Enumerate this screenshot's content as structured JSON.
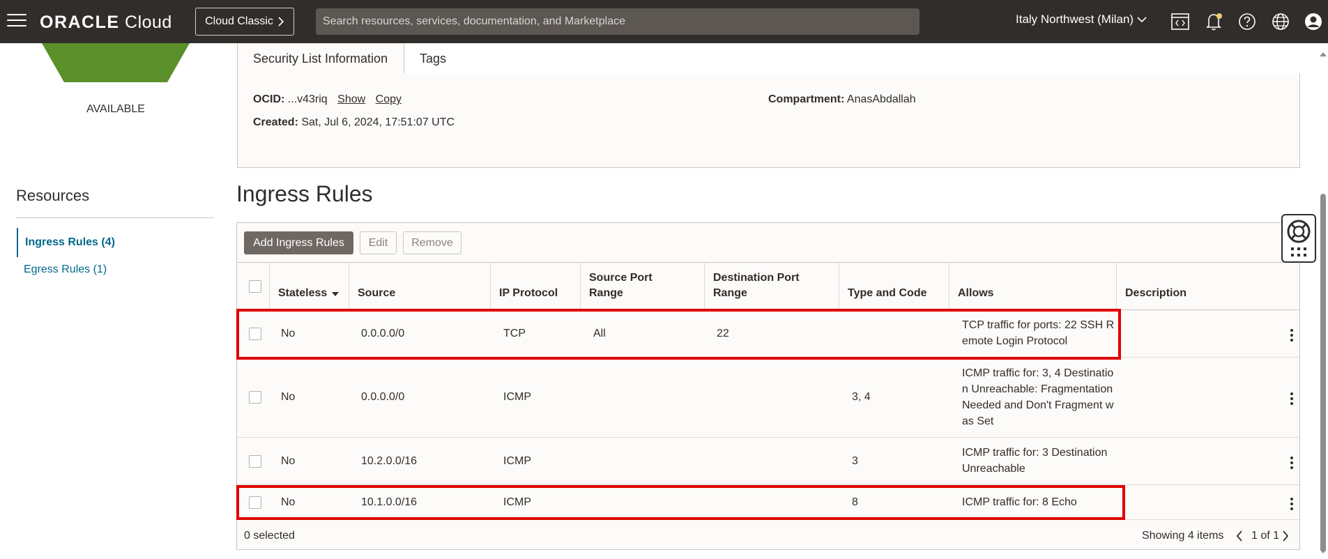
{
  "header": {
    "brand_bold": "ORACLE",
    "brand_light": "Cloud",
    "classic_label": "Cloud Classic",
    "search_placeholder": "Search resources, services, documentation, and Marketplace",
    "region": "Italy Northwest (Milan)",
    "icons": [
      "code-editor-icon",
      "bell-icon",
      "help-icon",
      "globe-icon",
      "user-icon"
    ]
  },
  "left": {
    "status": "AVAILABLE",
    "status_color": "#5a8f29",
    "resources_title": "Resources",
    "items": [
      {
        "label": "Ingress Rules (4)",
        "active": true
      },
      {
        "label": "Egress Rules (1)",
        "active": false
      }
    ]
  },
  "tabs": [
    "Security List Information",
    "Tags"
  ],
  "info": {
    "ocid_label": "OCID:",
    "ocid_value": "...v43riq",
    "show_label": "Show",
    "copy_label": "Copy",
    "created_label": "Created:",
    "created_value": "Sat, Jul 6, 2024, 17:51:07 UTC",
    "compartment_label": "Compartment:",
    "compartment_value": "AnasAbdallah"
  },
  "section_title": "Ingress Rules",
  "toolbar": {
    "add_label": "Add Ingress Rules",
    "edit_label": "Edit",
    "remove_label": "Remove"
  },
  "columns": [
    "Stateless",
    "Source",
    "IP Protocol",
    "Source Port Range",
    "Destination Port Range",
    "Type and Code",
    "Allows",
    "Description"
  ],
  "rows": [
    {
      "stateless": "No",
      "source": "0.0.0.0/0",
      "protocol": "TCP",
      "src_port": "All",
      "dst_port": "22",
      "type_code": "",
      "allows": "TCP traffic for ports: 22 SSH Remote Login Protocol",
      "description": ""
    },
    {
      "stateless": "No",
      "source": "0.0.0.0/0",
      "protocol": "ICMP",
      "src_port": "",
      "dst_port": "",
      "type_code": "3, 4",
      "allows": "ICMP traffic for: 3, 4 Destination Unreachable: Fragmentation Needed and Don't Fragment was Set",
      "description": ""
    },
    {
      "stateless": "No",
      "source": "10.2.0.0/16",
      "protocol": "ICMP",
      "src_port": "",
      "dst_port": "",
      "type_code": "3",
      "allows": "ICMP traffic for: 3 Destination Unreachable",
      "description": ""
    },
    {
      "stateless": "No",
      "source": "10.1.0.0/16",
      "protocol": "ICMP",
      "src_port": "",
      "dst_port": "",
      "type_code": "8",
      "allows": "ICMP traffic for: 8 Echo",
      "description": ""
    }
  ],
  "footer": {
    "selected": "0 selected",
    "showing": "Showing 4 items",
    "pagination": "1 of 1"
  },
  "highlight_color": "#e00000"
}
